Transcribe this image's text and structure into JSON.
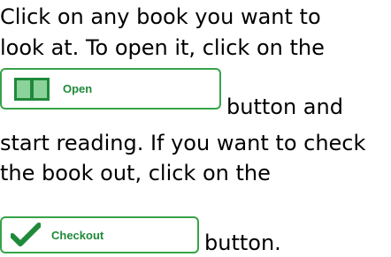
{
  "instructions": {
    "line1": "Click  on any book you want to",
    "line2": "look at. To open it, click on the",
    "after_open": "button and",
    "line4": "start reading. If you want to check",
    "line5": "the book out, click on the",
    "after_checkout": "button."
  },
  "buttons": {
    "open_label": "Open",
    "checkout_label": "Checkout",
    "open_icon": "book-icon",
    "checkout_icon": "checkmark-icon"
  },
  "colors": {
    "accent": "#37a349",
    "icon_dark": "#1f8a3a",
    "text": "#000000"
  }
}
